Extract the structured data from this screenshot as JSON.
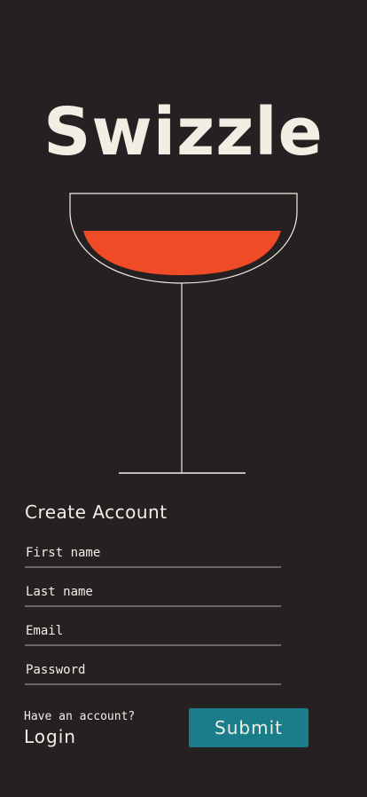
{
  "app": {
    "title": "Swizzle"
  },
  "illustration": {
    "icon": "cocktail-glass-icon",
    "liquid_color": "#ef4b26",
    "line_color": "#f1eee4"
  },
  "form": {
    "heading": "Create Account",
    "fields": {
      "first_name": {
        "placeholder": "First name",
        "value": ""
      },
      "last_name": {
        "placeholder": "Last name",
        "value": ""
      },
      "email": {
        "placeholder": "Email",
        "value": ""
      },
      "password": {
        "placeholder": "Password",
        "value": ""
      }
    }
  },
  "footer": {
    "login_prompt": "Have an account?",
    "login_label": "Login",
    "submit_label": "Submit"
  },
  "colors": {
    "background": "#252122",
    "text": "#f1eee4",
    "accent": "#1a7d8a",
    "field_underline": "#6a6667"
  }
}
